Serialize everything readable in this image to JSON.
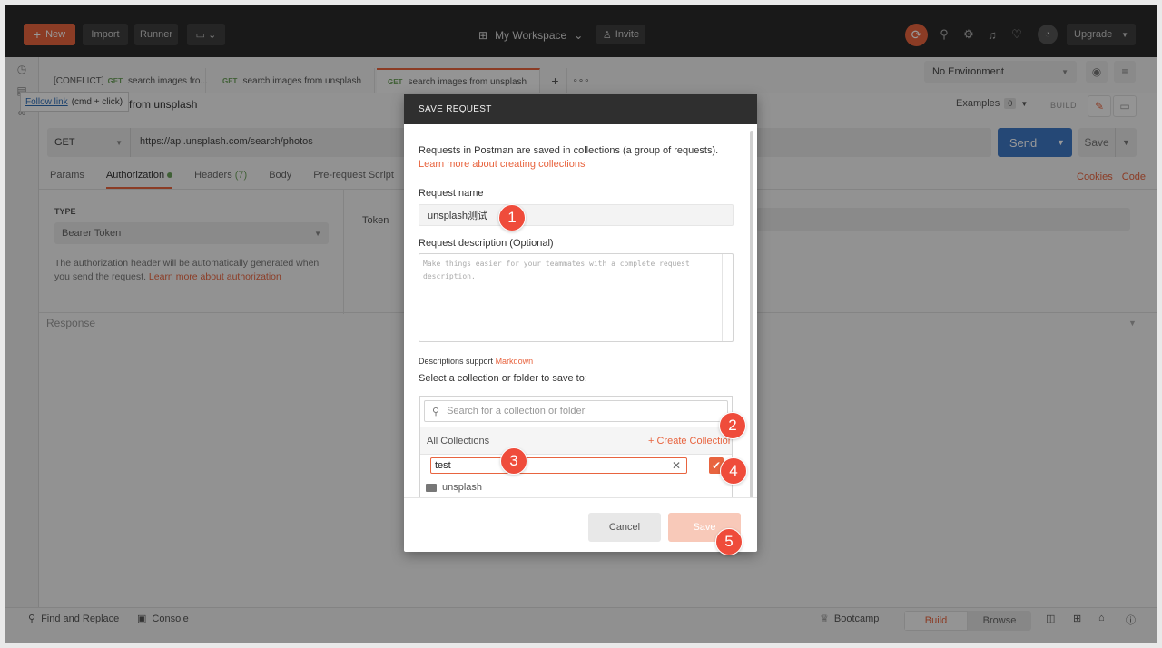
{
  "topbar": {
    "new_label": "New",
    "import_label": "Import",
    "runner_label": "Runner",
    "workspace_label": "My Workspace",
    "invite_label": "Invite",
    "upgrade_label": "Upgrade"
  },
  "tabs": [
    {
      "prefix": "[CONFLICT]",
      "method": "GET",
      "label": "search images fro..."
    },
    {
      "prefix": "",
      "method": "GET",
      "label": "search images from unsplash"
    },
    {
      "prefix": "",
      "method": "GET",
      "label": "search images from unsplash"
    }
  ],
  "environment": {
    "selected": "No Environment"
  },
  "tooltip": {
    "link": "Follow link",
    "hint": "(cmd + click)"
  },
  "request": {
    "title": "from unsplash",
    "examples_label": "Examples",
    "examples_count": "0",
    "build_label": "BUILD",
    "method": "GET",
    "url": "https://api.unsplash.com/search/photos",
    "send_label": "Send",
    "save_label": "Save",
    "subtabs": {
      "params": "Params",
      "authorization": "Authorization",
      "headers": "Headers",
      "headers_count": "(7)",
      "body": "Body",
      "prerequest": "Pre-request Script"
    },
    "cookies_label": "Cookies",
    "code_label": "Code"
  },
  "auth": {
    "type_label": "TYPE",
    "type_value": "Bearer Token",
    "desc": "The authorization header will be automatically generated when you send the request.",
    "desc_link": "Learn more about authorization",
    "token_label": "Token"
  },
  "response_label": "Response",
  "statusbar": {
    "find_replace": "Find and Replace",
    "console": "Console",
    "bootcamp": "Bootcamp",
    "build": "Build",
    "browse": "Browse"
  },
  "modal": {
    "title": "SAVE REQUEST",
    "intro": "Requests in Postman are saved in collections (a group of requests).",
    "intro_link": "Learn more about creating collections",
    "name_label": "Request name",
    "name_value": "unsplash测试",
    "desc_label": "Request description (Optional)",
    "desc_placeholder": "Make things easier for your teammates with a complete request description.",
    "markdown_prefix": "Descriptions support",
    "markdown_link": "Markdown",
    "select_label": "Select a collection or folder to save to:",
    "search_placeholder": "Search for a collection or folder",
    "all_collections": "All Collections",
    "create_collection": "+ Create Collection",
    "new_collection_value": "test",
    "folder_name": "unsplash",
    "cancel_label": "Cancel",
    "save_label": "Save"
  },
  "steps": [
    "1",
    "2",
    "3",
    "4",
    "5"
  ],
  "colors": {
    "accent": "#e8643f",
    "send": "#3f78c5",
    "marker": "#ef4c3b"
  }
}
